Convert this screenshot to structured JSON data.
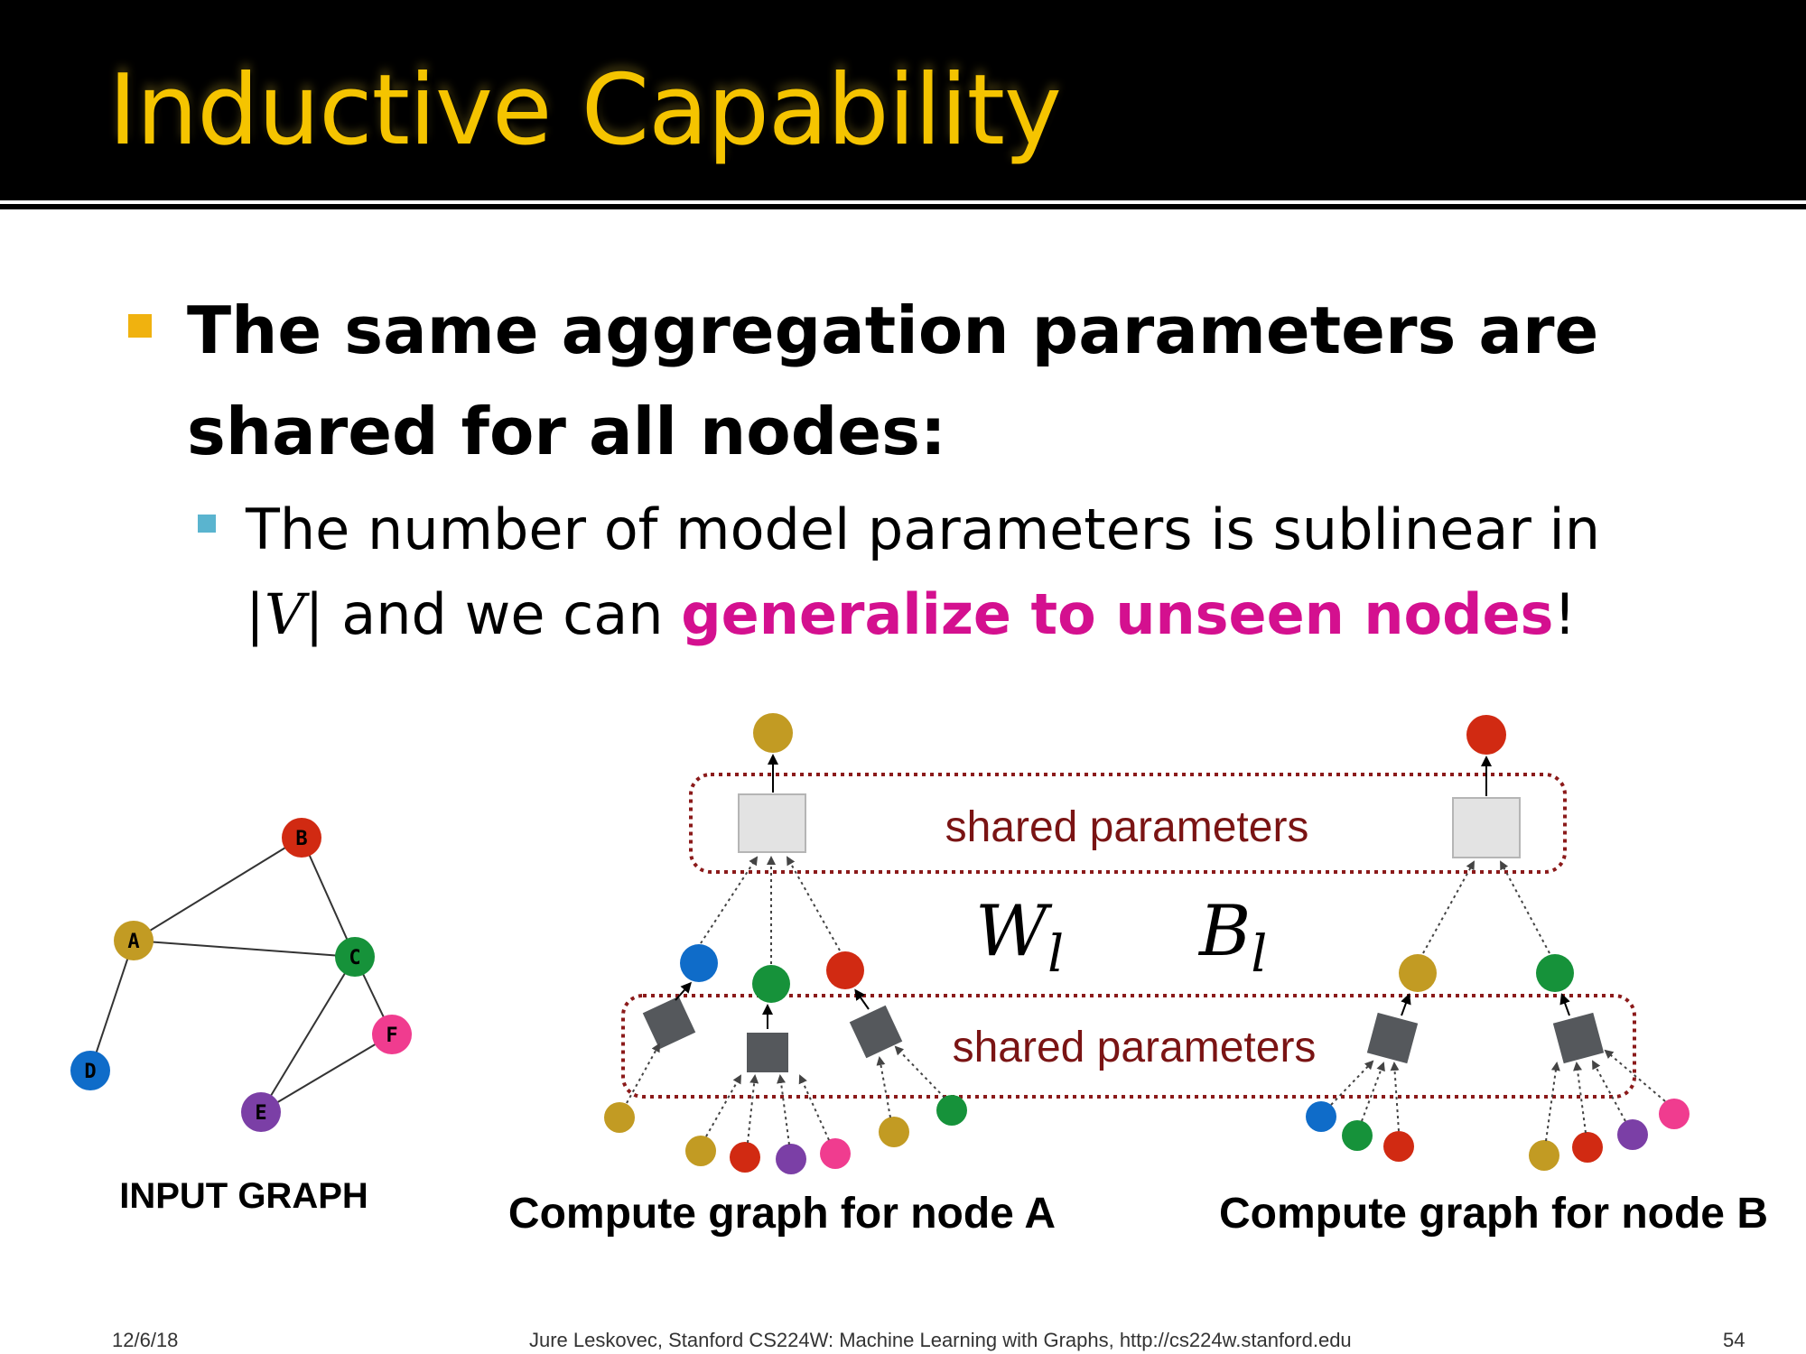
{
  "slide": {
    "title": "Inductive Capability",
    "bullet_main": "The same aggregation parameters are shared for all nodes:",
    "sub_bullet": {
      "prefix": "The number of model parameters is sublinear in",
      "math_term": "|V|",
      "middle": " and we can ",
      "highlight": "generalize to unseen nodes",
      "suffix": "!"
    }
  },
  "diagram": {
    "input_graph": {
      "caption": "INPUT GRAPH",
      "nodes": [
        {
          "id": "A",
          "color": "#c29b23"
        },
        {
          "id": "B",
          "color": "#d12a12"
        },
        {
          "id": "C",
          "color": "#16923a"
        },
        {
          "id": "D",
          "color": "#0f6cc9"
        },
        {
          "id": "E",
          "color": "#7b3fa6"
        },
        {
          "id": "F",
          "color": "#f03c8f"
        }
      ],
      "edges": [
        [
          "A",
          "B"
        ],
        [
          "A",
          "C"
        ],
        [
          "B",
          "C"
        ],
        [
          "A",
          "D"
        ],
        [
          "C",
          "E"
        ],
        [
          "C",
          "F"
        ],
        [
          "E",
          "F"
        ]
      ]
    },
    "shared_label_top": "shared parameters",
    "shared_label_bottom": "shared parameters",
    "weight_symbol": "W",
    "weight_subscript": "l",
    "bias_symbol": "B",
    "bias_subscript": "l",
    "caption_a": "Compute graph for node A",
    "caption_b": "Compute graph for node B",
    "colors": {
      "gold": "#c29b23",
      "red": "#d12a12",
      "green": "#16923a",
      "blue": "#0f6cc9",
      "purple": "#7b3fa6",
      "pink": "#f03c8f",
      "dashed_box": "#8b1a1a",
      "label": "#7a1414",
      "agg_box": "#55585c"
    }
  },
  "footer": {
    "date": "12/6/18",
    "citation": "Jure Leskovec, Stanford CS224W: Machine Learning with Graphs, http://cs224w.stanford.edu",
    "page_number": "54"
  }
}
